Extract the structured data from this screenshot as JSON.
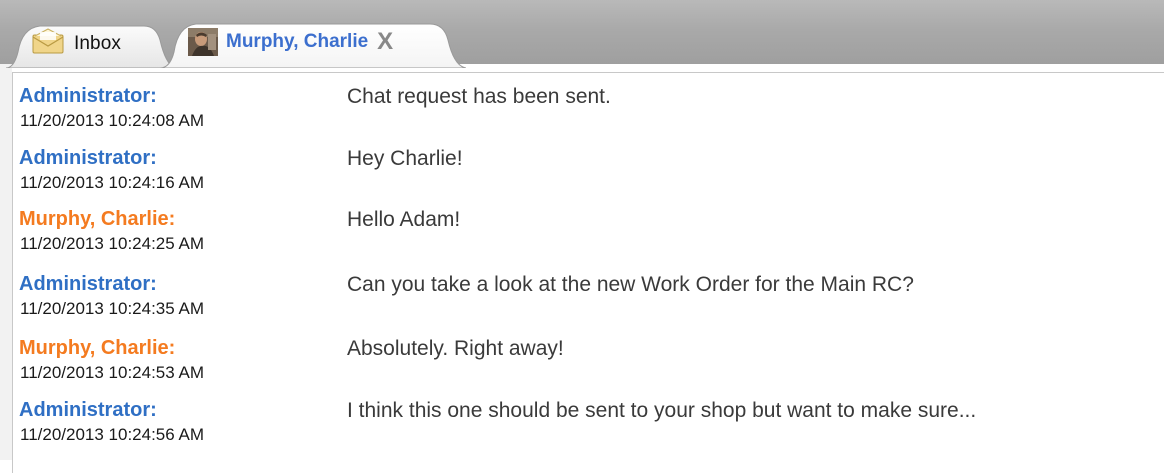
{
  "tabs": {
    "inbox": {
      "label": "Inbox",
      "icon": "envelope-icon"
    },
    "chat": {
      "label": "Murphy, Charlie",
      "icon": "avatar",
      "close_label": "X"
    }
  },
  "colors": {
    "administrator": "#2f6fc4",
    "contact": "#f47b20",
    "active_tab_text": "#3c6fce"
  },
  "messages": [
    {
      "sender": "Administrator:",
      "role": "admin",
      "timestamp": "11/20/2013 10:24:08 AM",
      "text": "Chat request has been sent."
    },
    {
      "sender": "Administrator:",
      "role": "admin",
      "timestamp": "11/20/2013 10:24:16 AM",
      "text": "Hey Charlie!"
    },
    {
      "sender": "Murphy, Charlie:",
      "role": "user",
      "timestamp": "11/20/2013 10:24:25 AM",
      "text": "Hello Adam!"
    },
    {
      "sender": "Administrator:",
      "role": "admin",
      "timestamp": "11/20/2013 10:24:35 AM",
      "text": "Can you take a look at the new Work Order for the Main RC?"
    },
    {
      "sender": "Murphy, Charlie:",
      "role": "user",
      "timestamp": "11/20/2013 10:24:53 AM",
      "text": "Absolutely. Right away!"
    },
    {
      "sender": "Administrator:",
      "role": "admin",
      "timestamp": "11/20/2013 10:24:56 AM",
      "text": "I think this one should be sent to your shop but want to make sure..."
    }
  ]
}
